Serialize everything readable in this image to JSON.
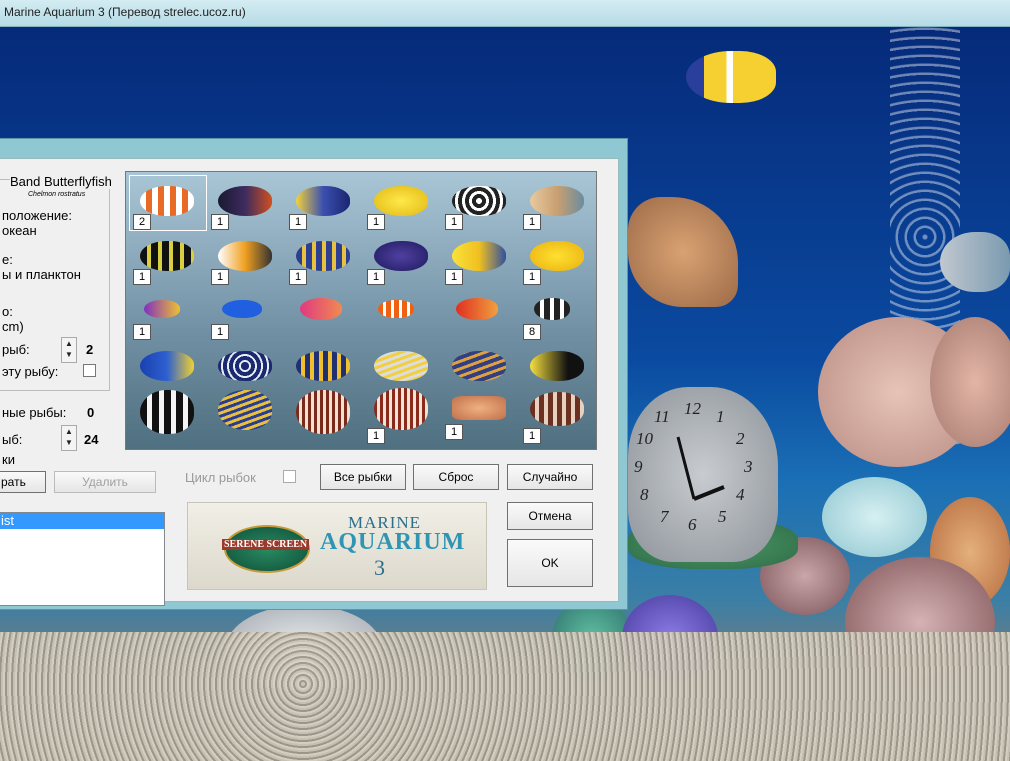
{
  "window": {
    "title": "Marine Aquarium 3 (Перевод strelec.ucoz.ru)"
  },
  "clock": {
    "numerals": [
      "12",
      "1",
      "2",
      "3",
      "4",
      "5",
      "6",
      "7",
      "8",
      "9",
      "10",
      "11"
    ]
  },
  "details": {
    "fish_name": "Band Butterflyfish",
    "latin_name": "Chelmon rostratus",
    "location_label": "положение:",
    "location_value": "океан",
    "food_label": "е:",
    "food_value": "ы и планктон",
    "size_label": "о:",
    "size_value": "cm)",
    "count_label": "рыб:",
    "count_value": "2",
    "exclude_label": "эту рыбу:"
  },
  "totals": {
    "special_label": "ные рыбы:",
    "special_value": "0",
    "total_label": "ыб:",
    "total_value": "24"
  },
  "lists": {
    "group_label": "ки",
    "select_button": "рать",
    "delete_button": "Удалить",
    "items": [
      "ist"
    ]
  },
  "fish_grid": {
    "counts": [
      "2",
      "1",
      "1",
      "1",
      "1",
      "1",
      "1",
      "1",
      "1",
      "1",
      "1",
      "1",
      "1",
      "1",
      "",
      "",
      "",
      "8",
      "",
      "",
      "",
      "",
      "",
      "",
      "",
      "",
      "",
      "1",
      "1",
      "1"
    ]
  },
  "controls": {
    "cycle_label": "Цикл рыбок",
    "all_fish_button": "Все рыбки",
    "reset_button": "Сброс",
    "random_button": "Случайно",
    "cancel_button": "Отмена",
    "ok_button": "OK"
  },
  "logo": {
    "brand": "SERENE SCREEN",
    "line1": "MARINE",
    "line2": "AQUARIUM",
    "line3": "3"
  }
}
